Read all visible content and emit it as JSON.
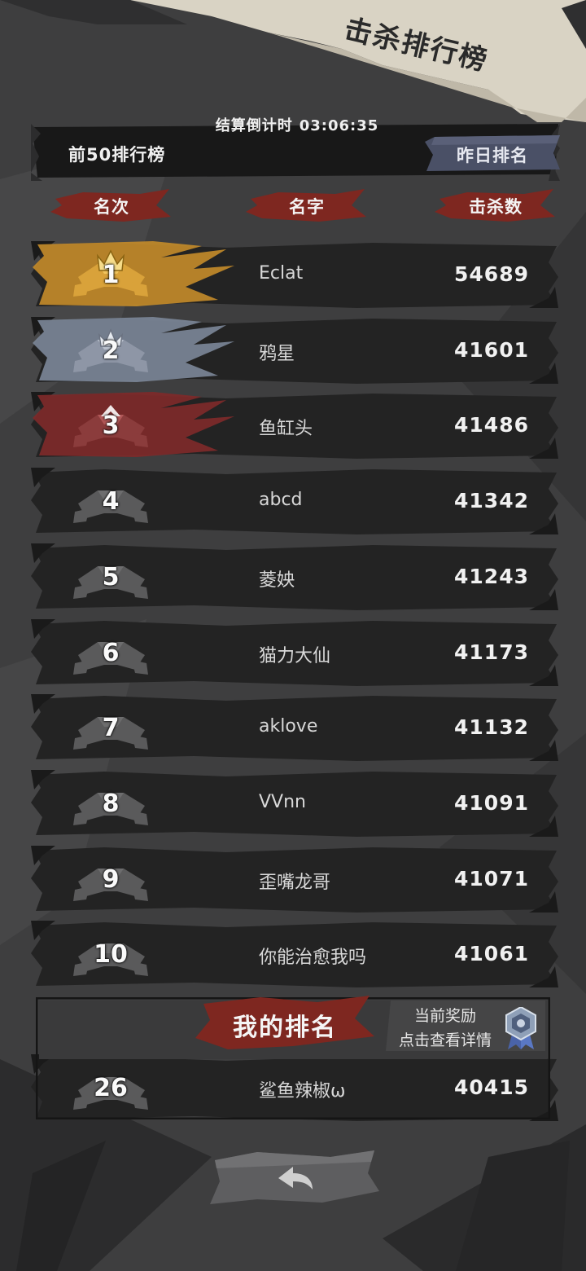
{
  "title": "击杀排行榜",
  "countdown": {
    "label": "结算倒计时",
    "time": "03:06:35"
  },
  "board": {
    "label": "前50排行榜",
    "yesterday_button": "昨日排名"
  },
  "columns": {
    "rank": "名次",
    "name": "名字",
    "kills": "击杀数"
  },
  "rankings": [
    {
      "rank": "1",
      "name": "Eclat",
      "kills": "54689"
    },
    {
      "rank": "2",
      "name": "鸦星",
      "kills": "41601"
    },
    {
      "rank": "3",
      "name": "鱼缸头",
      "kills": "41486"
    },
    {
      "rank": "4",
      "name": "abcd",
      "kills": "41342"
    },
    {
      "rank": "5",
      "name": "菱姎",
      "kills": "41243"
    },
    {
      "rank": "6",
      "name": "猫力大仙",
      "kills": "41173"
    },
    {
      "rank": "7",
      "name": "aklove",
      "kills": "41132"
    },
    {
      "rank": "8",
      "name": "VVnn",
      "kills": "41091"
    },
    {
      "rank": "9",
      "name": "歪嘴龙哥",
      "kills": "41071"
    },
    {
      "rank": "10",
      "name": "你能治愈我吗",
      "kills": "41061"
    }
  ],
  "my_rank": {
    "title": "我的排名",
    "reward_line1": "当前奖励",
    "reward_line2": "点击查看详情",
    "reward_icon": "rank-medal-icon",
    "rank": "26",
    "name": "鲨鱼辣椒ω",
    "kills": "40415"
  },
  "back_button_icon": "back-arrow-icon",
  "colors": {
    "gold": "#d49a2c",
    "silver": "#7f8796",
    "bronze": "#8a2d2d",
    "accent_red": "#8e2a22",
    "row_dark": "#232323"
  }
}
